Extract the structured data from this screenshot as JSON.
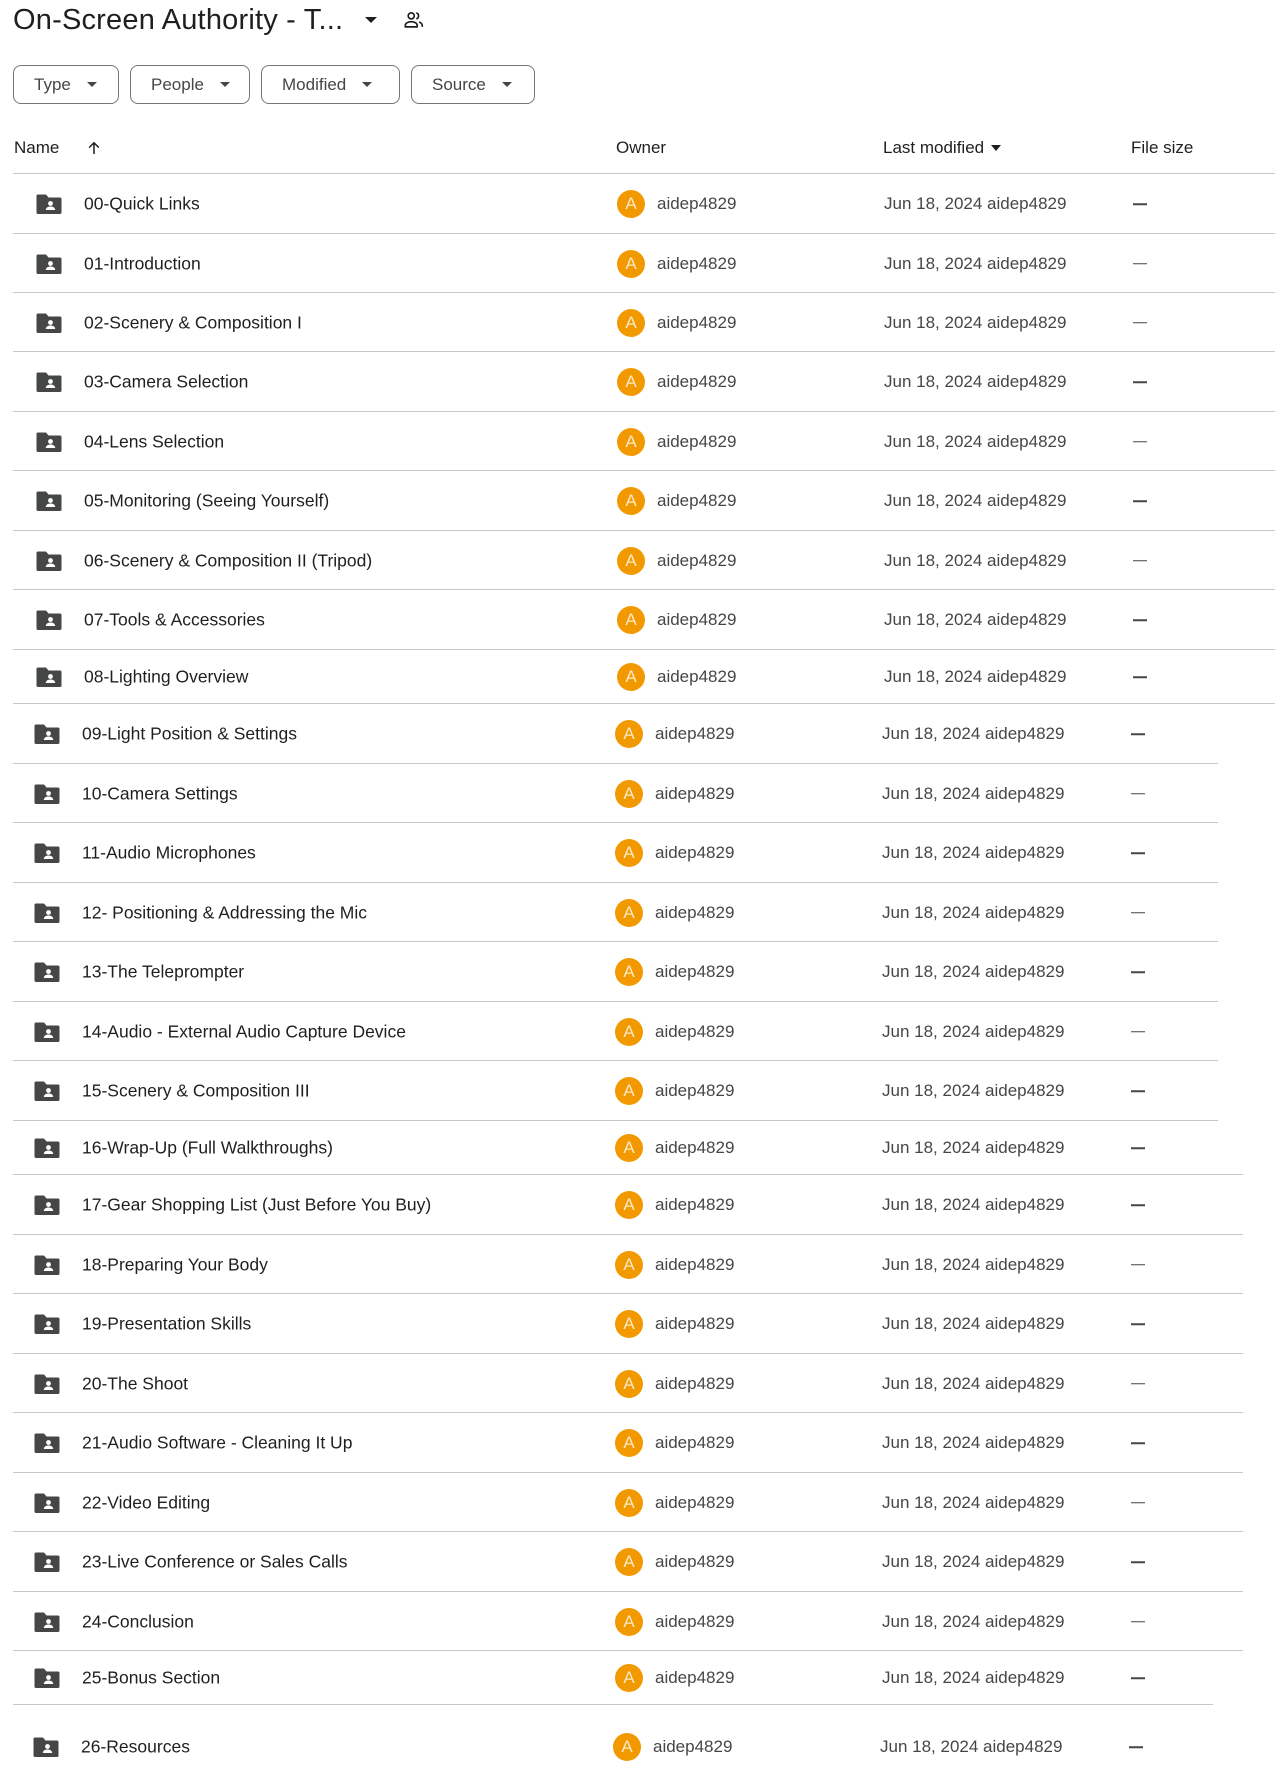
{
  "header": {
    "title": "On-Screen Authority - T...",
    "title_dropdown_icon": "caret-down-icon",
    "shared_icon": "people-icon"
  },
  "filters": [
    {
      "label": "Type"
    },
    {
      "label": "People"
    },
    {
      "label": "Modified"
    },
    {
      "label": "Source"
    }
  ],
  "columns": {
    "name": "Name",
    "name_sort": "ascending",
    "owner": "Owner",
    "last_modified": "Last modified",
    "last_modified_sort": "descending-caret",
    "file_size": "File size"
  },
  "colors": {
    "avatar_bg": "#f29900",
    "folder_icon": "#444746",
    "divider": "#c7c7c7"
  },
  "files": [
    {
      "name": "00-Quick Links",
      "type": "shared-folder",
      "owner_initial": "A",
      "owner": "aidep4829",
      "modified": "Jun 18, 2024 aidep4829",
      "size": "—"
    },
    {
      "name": "01-Introduction",
      "type": "shared-folder",
      "owner_initial": "A",
      "owner": "aidep4829",
      "modified": "Jun 18, 2024 aidep4829",
      "size": "—"
    },
    {
      "name": "02-Scenery & Composition I",
      "type": "shared-folder",
      "owner_initial": "A",
      "owner": "aidep4829",
      "modified": "Jun 18, 2024 aidep4829",
      "size": "—"
    },
    {
      "name": "03-Camera Selection",
      "type": "shared-folder",
      "owner_initial": "A",
      "owner": "aidep4829",
      "modified": "Jun 18, 2024 aidep4829",
      "size": "—"
    },
    {
      "name": "04-Lens Selection",
      "type": "shared-folder",
      "owner_initial": "A",
      "owner": "aidep4829",
      "modified": "Jun 18, 2024 aidep4829",
      "size": "—"
    },
    {
      "name": "05-Monitoring (Seeing Yourself)",
      "type": "shared-folder",
      "owner_initial": "A",
      "owner": "aidep4829",
      "modified": "Jun 18, 2024 aidep4829",
      "size": "—"
    },
    {
      "name": "06-Scenery & Composition II (Tripod)",
      "type": "shared-folder",
      "owner_initial": "A",
      "owner": "aidep4829",
      "modified": "Jun 18, 2024 aidep4829",
      "size": "—"
    },
    {
      "name": "07-Tools & Accessories",
      "type": "shared-folder",
      "owner_initial": "A",
      "owner": "aidep4829",
      "modified": "Jun 18, 2024 aidep4829",
      "size": "—"
    },
    {
      "name": "08-Lighting Overview",
      "type": "shared-folder",
      "owner_initial": "A",
      "owner": "aidep4829",
      "modified": "Jun 18, 2024 aidep4829",
      "size": "—"
    },
    {
      "name": "09-Light Position & Settings",
      "type": "shared-folder",
      "owner_initial": "A",
      "owner": "aidep4829",
      "modified": "Jun 18, 2024 aidep4829",
      "size": "—"
    },
    {
      "name": "10-Camera Settings",
      "type": "shared-folder",
      "owner_initial": "A",
      "owner": "aidep4829",
      "modified": "Jun 18, 2024 aidep4829",
      "size": "—"
    },
    {
      "name": "11-Audio Microphones",
      "type": "shared-folder",
      "owner_initial": "A",
      "owner": "aidep4829",
      "modified": "Jun 18, 2024 aidep4829",
      "size": "—"
    },
    {
      "name": "12- Positioning & Addressing the Mic",
      "type": "shared-folder",
      "owner_initial": "A",
      "owner": "aidep4829",
      "modified": "Jun 18, 2024 aidep4829",
      "size": "—"
    },
    {
      "name": "13-The Teleprompter",
      "type": "shared-folder",
      "owner_initial": "A",
      "owner": "aidep4829",
      "modified": "Jun 18, 2024 aidep4829",
      "size": "—"
    },
    {
      "name": "14-Audio - External Audio Capture Device",
      "type": "shared-folder",
      "owner_initial": "A",
      "owner": "aidep4829",
      "modified": "Jun 18, 2024 aidep4829",
      "size": "—"
    },
    {
      "name": "15-Scenery & Composition III",
      "type": "shared-folder",
      "owner_initial": "A",
      "owner": "aidep4829",
      "modified": "Jun 18, 2024 aidep4829",
      "size": "—"
    },
    {
      "name": "16-Wrap-Up (Full Walkthroughs)",
      "type": "shared-folder",
      "owner_initial": "A",
      "owner": "aidep4829",
      "modified": "Jun 18, 2024 aidep4829",
      "size": "—"
    },
    {
      "name": "17-Gear Shopping List (Just Before You Buy)",
      "type": "shared-folder",
      "owner_initial": "A",
      "owner": "aidep4829",
      "modified": "Jun 18, 2024 aidep4829",
      "size": "—"
    },
    {
      "name": "18-Preparing Your Body",
      "type": "shared-folder",
      "owner_initial": "A",
      "owner": "aidep4829",
      "modified": "Jun 18, 2024 aidep4829",
      "size": "—"
    },
    {
      "name": "19-Presentation Skills",
      "type": "shared-folder",
      "owner_initial": "A",
      "owner": "aidep4829",
      "modified": "Jun 18, 2024 aidep4829",
      "size": "—"
    },
    {
      "name": "20-The Shoot",
      "type": "shared-folder",
      "owner_initial": "A",
      "owner": "aidep4829",
      "modified": "Jun 18, 2024 aidep4829",
      "size": "—"
    },
    {
      "name": "21-Audio Software - Cleaning It Up",
      "type": "shared-folder",
      "owner_initial": "A",
      "owner": "aidep4829",
      "modified": "Jun 18, 2024 aidep4829",
      "size": "—"
    },
    {
      "name": "22-Video Editing",
      "type": "shared-folder",
      "owner_initial": "A",
      "owner": "aidep4829",
      "modified": "Jun 18, 2024 aidep4829",
      "size": "—"
    },
    {
      "name": "23-Live Conference or Sales Calls",
      "type": "shared-folder",
      "owner_initial": "A",
      "owner": "aidep4829",
      "modified": "Jun 18, 2024 aidep4829",
      "size": "—"
    },
    {
      "name": "24-Conclusion",
      "type": "shared-folder",
      "owner_initial": "A",
      "owner": "aidep4829",
      "modified": "Jun 18, 2024 aidep4829",
      "size": "—"
    },
    {
      "name": "25-Bonus Section",
      "type": "shared-folder",
      "owner_initial": "A",
      "owner": "aidep4829",
      "modified": "Jun 18, 2024 aidep4829",
      "size": "—"
    },
    {
      "name": "26-Resources",
      "type": "shared-folder",
      "owner_initial": "A",
      "owner": "aidep4829",
      "modified": "Jun 18, 2024 aidep4829",
      "size": "—"
    }
  ]
}
